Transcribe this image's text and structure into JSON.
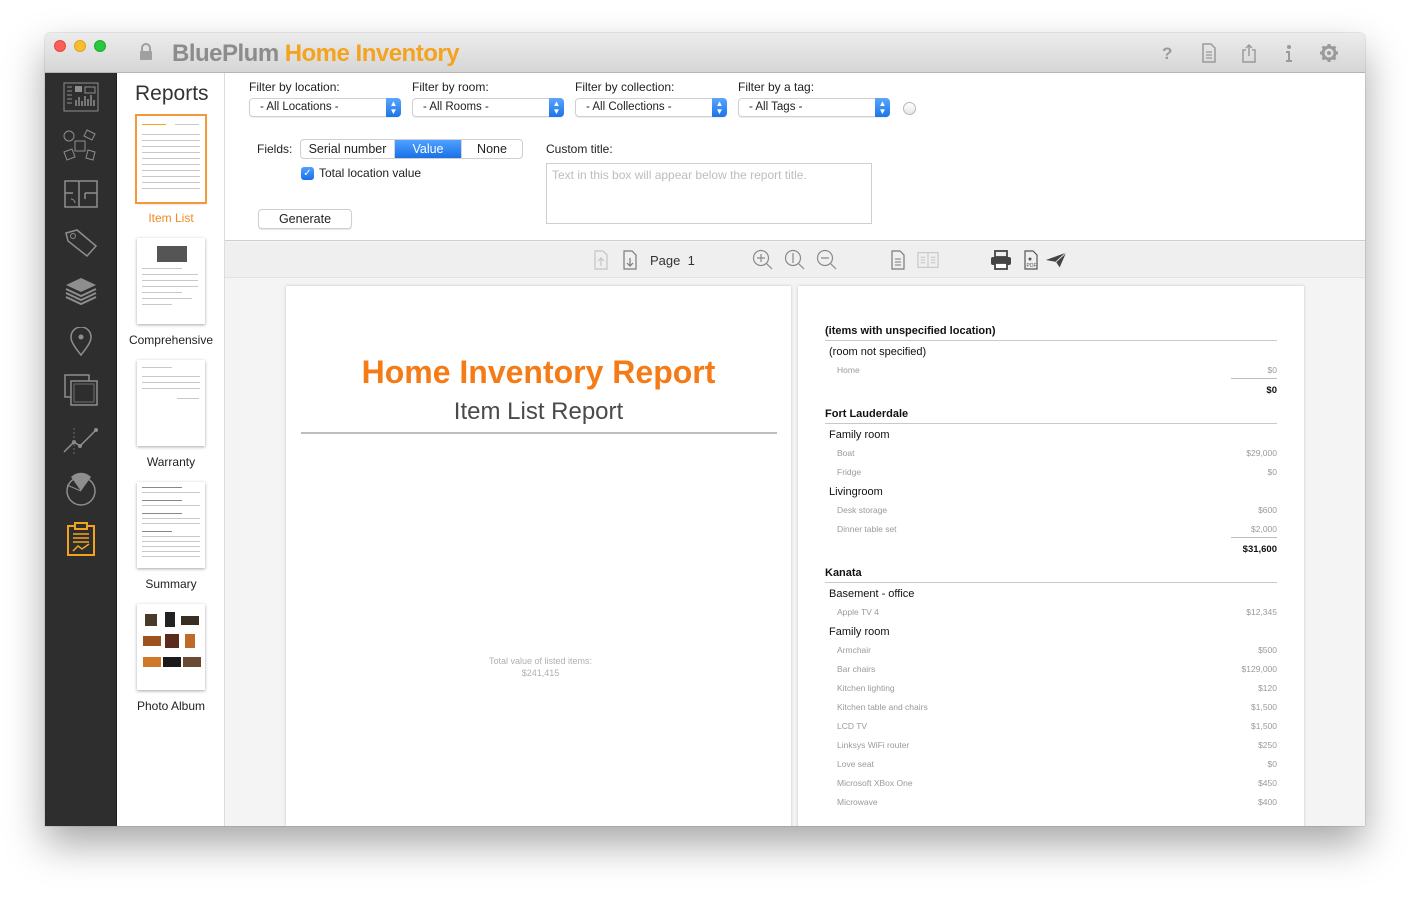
{
  "window": {
    "brand": "BluePlum",
    "product": "Home Inventory",
    "toolbar_icons": [
      "help-icon",
      "document-icon",
      "share-icon",
      "info-icon",
      "gear-icon"
    ]
  },
  "iconbar": {
    "items": [
      {
        "name": "dashboard",
        "icon": "dashboard-icon",
        "active": false
      },
      {
        "name": "items",
        "icon": "items-icon",
        "active": false
      },
      {
        "name": "floorplan",
        "icon": "floorplan-icon",
        "active": false
      },
      {
        "name": "tags",
        "icon": "tag-icon",
        "active": false
      },
      {
        "name": "collections",
        "icon": "layers-icon",
        "active": false
      },
      {
        "name": "locations",
        "icon": "location-pin-icon",
        "active": false
      },
      {
        "name": "photos",
        "icon": "photos-icon",
        "active": false
      },
      {
        "name": "trends",
        "icon": "chart-line-icon",
        "active": false
      },
      {
        "name": "statistics",
        "icon": "pie-chart-icon",
        "active": false
      },
      {
        "name": "reports",
        "icon": "clipboard-report-icon",
        "active": true
      }
    ],
    "active_color": "#f4a31f"
  },
  "reports_panel": {
    "title": "Reports",
    "reports": [
      {
        "label": "Item List",
        "selected": true
      },
      {
        "label": "Comprehensive",
        "selected": false
      },
      {
        "label": "Warranty",
        "selected": false
      },
      {
        "label": "Summary",
        "selected": false
      },
      {
        "label": "Photo Album",
        "selected": false
      }
    ]
  },
  "filters": {
    "location": {
      "label": "Filter by location:",
      "value": "- All Locations -"
    },
    "room": {
      "label": "Filter by room:",
      "value": "- All Rooms -"
    },
    "collection": {
      "label": "Filter by collection:",
      "value": "- All Collections -"
    },
    "tag": {
      "label": "Filter by  a tag:",
      "value": "- All Tags -"
    }
  },
  "fields": {
    "label": "Fields:",
    "options": [
      "Serial number",
      "Value",
      "None"
    ],
    "selected": "Value",
    "total_location_value": {
      "label": "Total location value",
      "checked": true
    }
  },
  "custom_title": {
    "label": "Custom title:",
    "value": "",
    "placeholder": "Text in this box will appear below the report title."
  },
  "generate_label": "Generate",
  "viewer": {
    "page_label": "Page",
    "page_number": "1"
  },
  "report": {
    "title": "Home Inventory Report",
    "subtitle": "Item List Report",
    "total_label": "Total value of listed items:",
    "total_value": "$241,415",
    "locations": [
      {
        "name": "(items with unspecified location)",
        "rooms": [
          {
            "name": "(room not specified)",
            "items": [
              {
                "name": "Home",
                "value": "$0"
              }
            ]
          }
        ],
        "total": "$0"
      },
      {
        "name": "Fort Lauderdale",
        "rooms": [
          {
            "name": "Family room",
            "items": [
              {
                "name": "Boat",
                "value": "$29,000"
              },
              {
                "name": "Fridge",
                "value": "$0"
              }
            ]
          },
          {
            "name": "Livingroom",
            "items": [
              {
                "name": "Desk storage",
                "value": "$600"
              },
              {
                "name": "Dinner table set",
                "value": "$2,000"
              }
            ]
          }
        ],
        "total": "$31,600"
      },
      {
        "name": "Kanata",
        "rooms": [
          {
            "name": "Basement - office",
            "items": [
              {
                "name": "Apple TV  4",
                "value": "$12,345"
              }
            ]
          },
          {
            "name": "Family room",
            "items": [
              {
                "name": "Armchair",
                "value": "$500"
              },
              {
                "name": "Bar chairs",
                "value": "$129,000"
              },
              {
                "name": "Kitchen lighting",
                "value": "$120"
              },
              {
                "name": "Kitchen table and chairs",
                "value": "$1,500"
              },
              {
                "name": "LCD TV",
                "value": "$1,500"
              },
              {
                "name": "Linksys WiFi router",
                "value": "$250"
              },
              {
                "name": "Love seat",
                "value": "$0"
              },
              {
                "name": "Microsoft XBox One",
                "value": "$450"
              },
              {
                "name": "Microwave",
                "value": "$400"
              }
            ]
          }
        ],
        "total": null
      }
    ]
  }
}
